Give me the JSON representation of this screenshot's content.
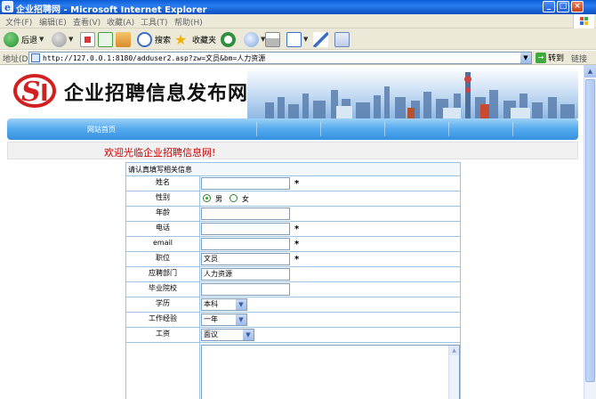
{
  "window": {
    "title": "企业招聘网 - Microsoft Internet Explorer",
    "buttons": {
      "minimize": "_",
      "maximize": "□",
      "close": "×"
    }
  },
  "menu": [
    "文件(F)",
    "编辑(E)",
    "查看(V)",
    "收藏(A)",
    "工具(T)",
    "帮助(H)"
  ],
  "toolbar": {
    "back": "后退",
    "search": "搜索",
    "favorites": "收藏夹"
  },
  "address": {
    "label": "地址(D)",
    "url": "http://127.0.0.1:8180/adduser2.asp?zw=文员&bm=人力资源",
    "go": "转到",
    "links": "链接"
  },
  "site": {
    "title": "企业招聘信息发布网",
    "nav_home": "网站首页",
    "welcome": "欢迎光临企业招聘信息网!"
  },
  "form": {
    "header": "请认真填写相关信息",
    "labels": {
      "name": "姓名",
      "gender": "性别",
      "age": "年龄",
      "phone": "电话",
      "email": "email",
      "position": "职位",
      "department": "应聘部门",
      "school": "毕业院校",
      "education": "学历",
      "experience": "工作经验",
      "salary": "工资"
    },
    "required_mark": "*",
    "gender_options": {
      "male": "男",
      "female": "女",
      "selected": "male"
    },
    "values": {
      "name": "",
      "age": "",
      "phone": "",
      "email": "",
      "position": "文员",
      "department": "人力资源",
      "school": "",
      "education": "本科",
      "experience": "一年",
      "salary": "面议",
      "notes": ""
    }
  },
  "colors": {
    "titlebar": "#0a5cd6",
    "nav": "#52a9ee",
    "welcome_text": "#c60000",
    "table_border": "#9dc3e3"
  }
}
